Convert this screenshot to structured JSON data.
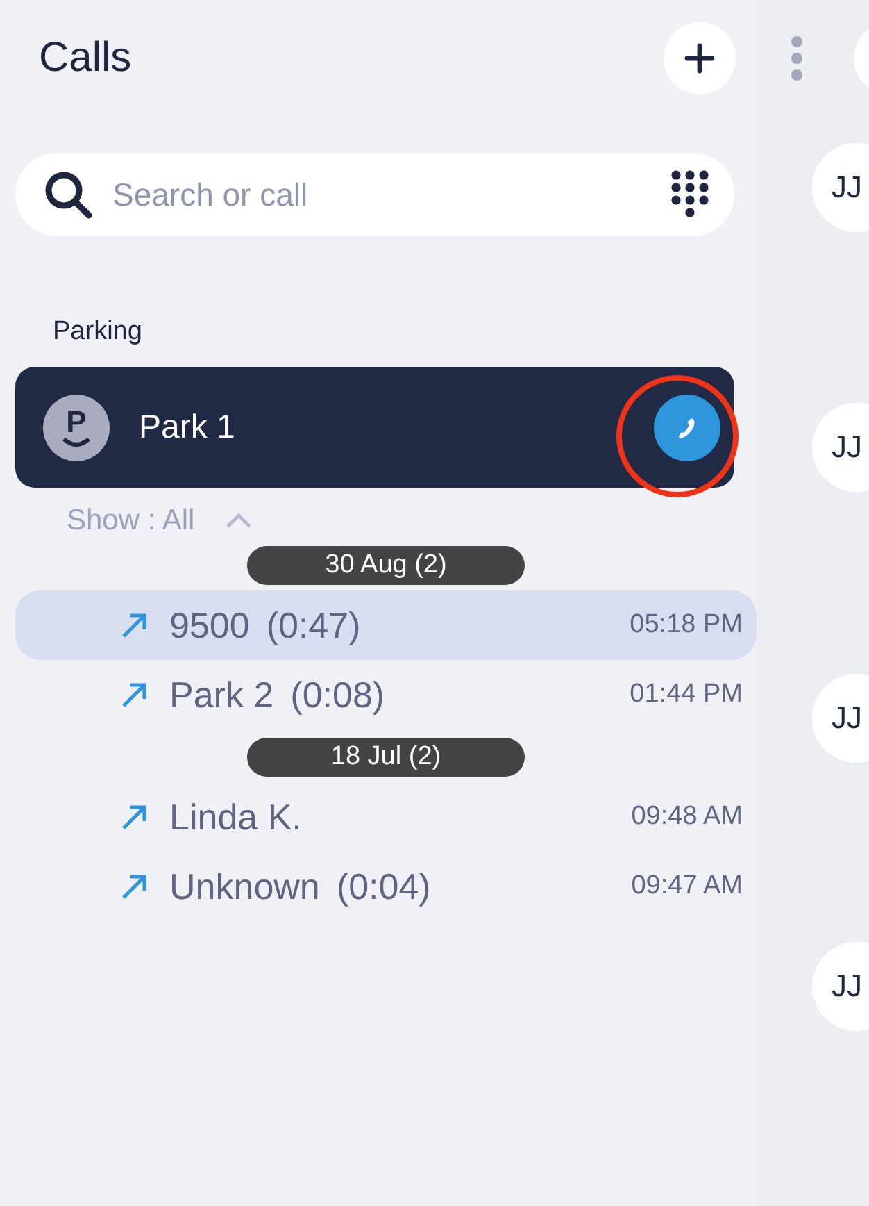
{
  "header": {
    "title": "Calls"
  },
  "search": {
    "placeholder": "Search or call"
  },
  "parking": {
    "label": "Parking",
    "call": {
      "avatar": "P",
      "name": "Park 1",
      "highlighted": true
    }
  },
  "filter": {
    "label": "Show : All",
    "expanded": true
  },
  "groups": [
    {
      "date": "30 Aug (2)",
      "calls": [
        {
          "name": "9500",
          "duration": "(0:47)",
          "time": "05:18 PM",
          "selected": true
        },
        {
          "name": "Park 2",
          "duration": "(0:08)",
          "time": "01:44 PM",
          "selected": false
        }
      ]
    },
    {
      "date": "18 Jul (2)",
      "calls": [
        {
          "name": "Linda K.",
          "time": "09:48 AM",
          "selected": false
        },
        {
          "name": "Unknown",
          "duration": "(0:04)",
          "time": "09:47 AM",
          "selected": false
        }
      ]
    }
  ],
  "contacts": [
    {
      "initials": "JJ"
    },
    {
      "initials": "JJ"
    },
    {
      "initials": "JJ"
    },
    {
      "initials": "JJ"
    }
  ]
}
